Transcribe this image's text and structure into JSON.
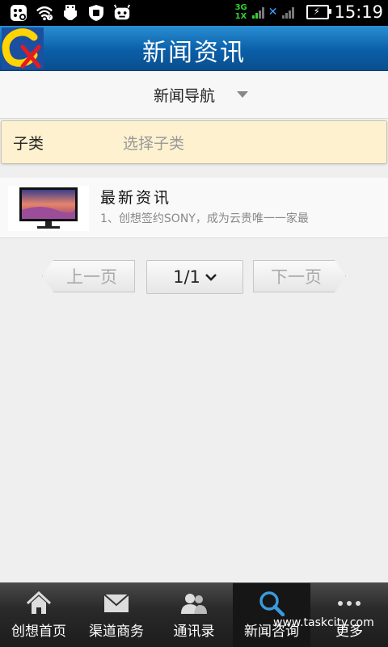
{
  "status_bar": {
    "network_top": "3G",
    "network_bottom": "1X",
    "time": "15:19",
    "icons": [
      "bb-icon",
      "wifi-icon",
      "usb-icon",
      "shield-icon",
      "android-icon",
      "signal-icon",
      "battery-icon"
    ]
  },
  "header": {
    "title": "新闻资讯",
    "logo_icon": "app-logo"
  },
  "nav": {
    "label": "新闻导航",
    "dropdown_icon": "caret-down-icon"
  },
  "subcategory": {
    "label": "子类",
    "placeholder": "选择子类"
  },
  "news_list": [
    {
      "title": "最新资讯",
      "description": "1、创想签约SONY，成为云贵唯一一家最",
      "thumbnail_icon": "monitor-image"
    }
  ],
  "pager": {
    "prev_label": "上一页",
    "page_indicator": "1/1",
    "next_label": "下一页"
  },
  "tab_bar": {
    "items": [
      {
        "label": "创想首页",
        "icon": "home-icon"
      },
      {
        "label": "渠道商务",
        "icon": "mail-icon"
      },
      {
        "label": "通讯录",
        "icon": "contacts-icon"
      },
      {
        "label": "新闻咨询",
        "icon": "search-icon"
      },
      {
        "label": "更多",
        "icon": "more-icon"
      }
    ],
    "active_index": 3
  },
  "watermark": "www.taskcity.com",
  "colors": {
    "header_blue": "#0a5fa8",
    "subcategory_bg": "#fdf1cf",
    "tabbar_dark": "#2a2a2a",
    "active_icon_blue": "#3a9bdc"
  }
}
